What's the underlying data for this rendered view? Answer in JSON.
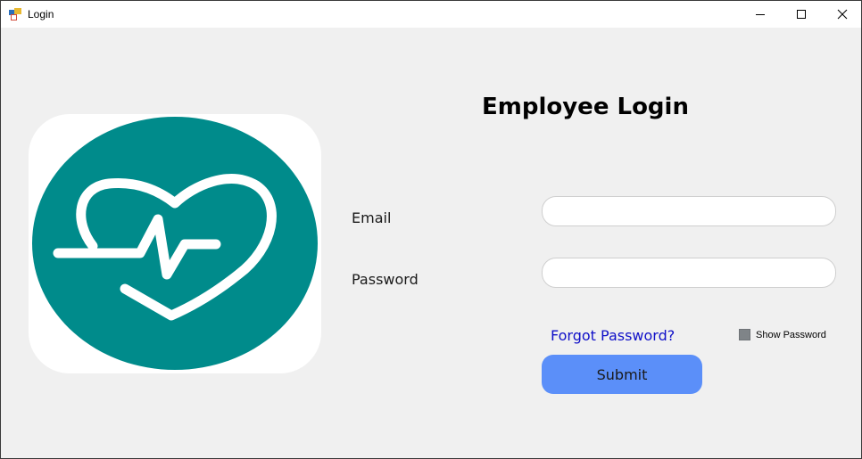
{
  "window": {
    "title": "Login",
    "icon": "winforms-app-icon",
    "controls": {
      "minimize_icon": "minimize-icon",
      "maximize_icon": "maximize-icon",
      "close_icon": "close-icon"
    }
  },
  "logo": {
    "icon": "heart-pulse-icon",
    "colors": {
      "background": "#ffffff",
      "circle": "#008b8b",
      "stroke": "#ffffff"
    }
  },
  "form": {
    "heading": "Employee Login",
    "email_label": "Email",
    "email_value": "",
    "password_label": "Password",
    "password_value": "",
    "forgot_link": "Forgot Password?",
    "show_password_label": "Show Password",
    "show_password_checked": false,
    "submit_label": "Submit"
  },
  "colors": {
    "window_bg": "#f0f0f0",
    "link": "#1010c8",
    "button": "#5b8ff9",
    "checkbox": "#7f8488"
  }
}
